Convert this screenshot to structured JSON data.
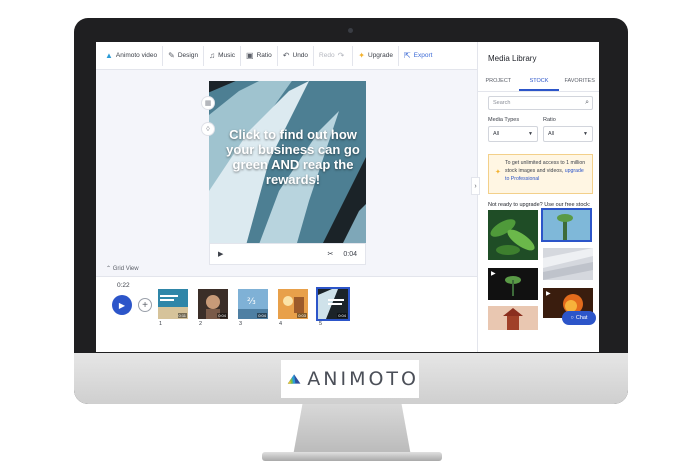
{
  "brand": {
    "logo_text": "ANIMOTO"
  },
  "toolbar": {
    "project_name": "Animoto video",
    "design": "Design",
    "music": "Music",
    "ratio": "Ratio",
    "undo": "Undo",
    "redo": "Redo",
    "upgrade": "Upgrade",
    "export": "Export"
  },
  "preview": {
    "caption": "Click to find out how your business can go green AND reap the rewards!",
    "duration": "0:04"
  },
  "timeline": {
    "grid_view_label": "Grid View",
    "current_time": "0:22",
    "scenes": [
      {
        "number": "1",
        "duration": "0:11"
      },
      {
        "number": "2",
        "duration": "0:04"
      },
      {
        "number": "3",
        "duration": "0:04"
      },
      {
        "number": "4",
        "duration": "0:03"
      },
      {
        "number": "5",
        "duration": "0:04"
      }
    ]
  },
  "library": {
    "title": "Media Library",
    "tabs": [
      "PROJECT",
      "STOCK",
      "FAVORITES"
    ],
    "active_tab": "STOCK",
    "search_placeholder": "Search",
    "media_types_label": "Media Types",
    "media_types_value": "All",
    "ratio_label": "Ratio",
    "ratio_value": "All",
    "promo_text": "To get unlimited access to 1 million stock images and videos,",
    "promo_link": "upgrade to Professional",
    "free_stock_label": "Not ready to upgrade? Use our free stock:",
    "chat_label": "Chat"
  },
  "colors": {
    "accent": "#2c55c9",
    "promo_bg": "#fff6e3"
  }
}
